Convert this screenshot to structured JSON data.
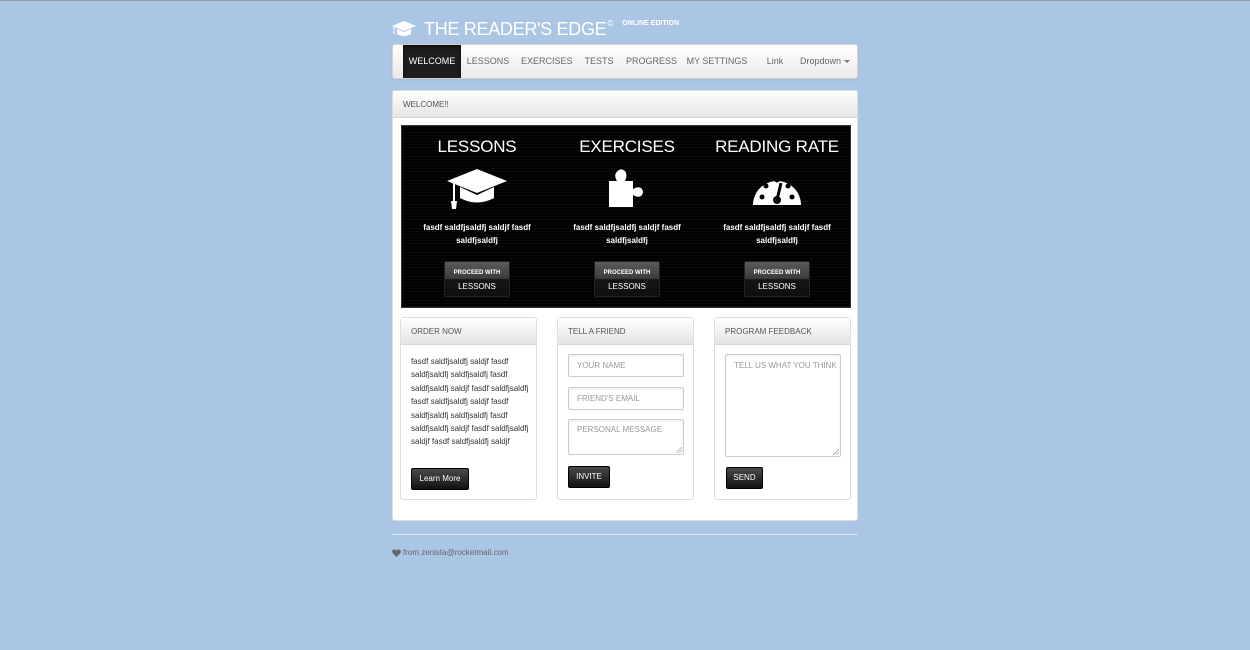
{
  "brand": {
    "title": "THE READER'S EDGE",
    "reg": "©",
    "edition": "ONLINE EDITION",
    "icon": "graduation-cap-icon"
  },
  "nav": {
    "items": [
      {
        "label": "WELCOME",
        "active": true
      },
      {
        "label": "LESSONS"
      },
      {
        "label": "EXERCISES"
      },
      {
        "label": "TESTS"
      },
      {
        "label": "PROGRESS"
      },
      {
        "label": "MY SETTINGS"
      },
      {
        "label": "Link"
      },
      {
        "label": "Dropdown"
      }
    ]
  },
  "welcome": {
    "heading": "WELCOME!!",
    "features": [
      {
        "title": "LESSONS",
        "icon": "graduation-cap-icon",
        "text": "fasdf saldfjsaldfj saldjf fasdf saldfjsaldfj",
        "button_line1": "PROCEED WITH",
        "button_line2": "LESSONS"
      },
      {
        "title": "EXERCISES",
        "icon": "puzzle-piece-icon",
        "text": "fasdf saldfjsaldfj saldjf fasdf saldfjsaldfj",
        "button_line1": "PROCEED WITH",
        "button_line2": "LESSONS"
      },
      {
        "title": "READING RATE",
        "icon": "speedometer-icon",
        "text": "fasdf saldfjsaldfj saldjf fasdf saldfjsaldfj",
        "button_line1": "PROCEED WITH",
        "button_line2": "LESSONS"
      }
    ]
  },
  "order": {
    "heading": "ORDER NOW",
    "text": "fasdf saldfjsaldfj saldjf fasdf saldfjsaldfj saldfjsaldfj fasdf saldfjsaldfj saldjf fasdf saldfjsaldfj fasdf saldfjsaldfj saldjf fasdf saldfjsaldfj saldfjsaldfj fasdf saldfjsaldfj saldjf fasdf saldfjsaldfj saldjf fasdf saldfjsaldfj saldjf",
    "button": "Learn More"
  },
  "friend": {
    "heading": "TELL A FRIEND",
    "name_placeholder": "YOUR NAME",
    "email_placeholder": "FRIEND'S EMAIL",
    "message_placeholder": "PERSONAL MESSAGE",
    "button": "INVITE"
  },
  "feedback": {
    "heading": "PROGRAM FEEDBACK",
    "placeholder": "TELL US WHAT YOU THINK",
    "button": "SEND"
  },
  "footer": {
    "text": "from zenista@rocketmail.com",
    "icon": "heart-icon"
  },
  "colors": {
    "background": "#abc6e5",
    "nav_active": "#1e1e1e",
    "hero": "#000000"
  }
}
